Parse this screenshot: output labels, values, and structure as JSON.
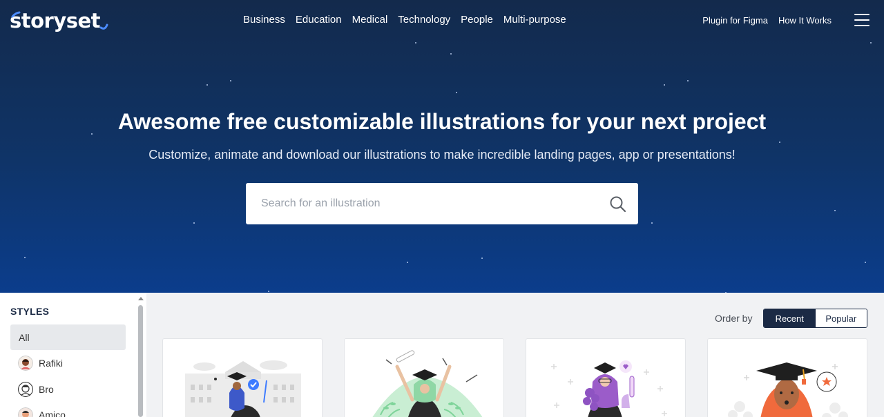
{
  "brand": {
    "logo_text": "storyset"
  },
  "nav": {
    "center": [
      "Business",
      "Education",
      "Medical",
      "Technology",
      "People",
      "Multi-purpose"
    ],
    "right": [
      "Plugin for Figma",
      "How It Works"
    ],
    "menu_icon": "hamburger-menu-icon"
  },
  "hero": {
    "title": "Awesome free customizable illustrations for your next project",
    "subtitle": "Customize, animate and download our illustrations to make incredible landing pages, app or presentations!"
  },
  "search": {
    "placeholder": "Search for an illustration",
    "value": "",
    "icon": "search-icon"
  },
  "sidebar": {
    "heading": "STYLES",
    "items": [
      {
        "label": "All",
        "active": true
      },
      {
        "label": "Rafiki",
        "active": false
      },
      {
        "label": "Bro",
        "active": false
      },
      {
        "label": "Amico",
        "active": false
      }
    ]
  },
  "order": {
    "label": "Order by",
    "options": [
      "Recent",
      "Popular"
    ],
    "selected": "Recent"
  },
  "colors": {
    "hero_top": "#132a4c",
    "hero_bottom": "#0b3d8c",
    "accent": "#1b2a45",
    "check": "#3d7bff",
    "green": "#7fd49a",
    "purple": "#9b5cc9",
    "orange": "#f06a3c"
  },
  "cards": [
    {
      "subject": "graduate with diploma",
      "icon": "graduation-illustration"
    },
    {
      "subject": "celebrating graduate",
      "icon": "graduation-illustration"
    },
    {
      "subject": "graduate with flowers",
      "icon": "graduation-illustration"
    },
    {
      "subject": "graduate portrait",
      "icon": "graduation-illustration"
    }
  ]
}
